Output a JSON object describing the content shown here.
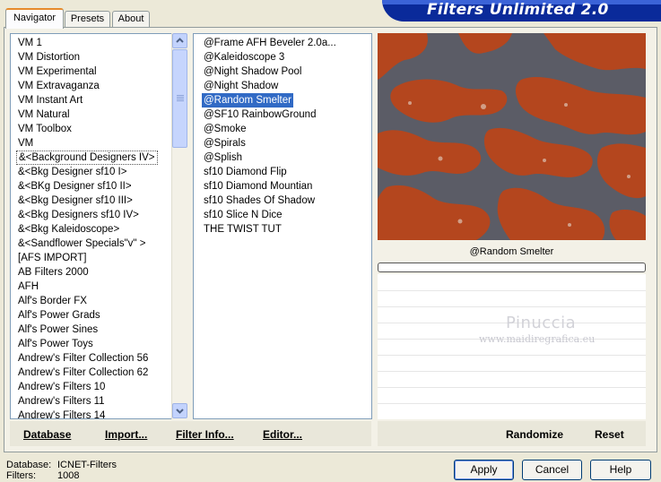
{
  "tabs": [
    "Navigator",
    "Presets",
    "About"
  ],
  "banner_title": "Filters Unlimited 2.0",
  "categories": [
    "VM 1",
    "VM Distortion",
    "VM Experimental",
    "VM Extravaganza",
    "VM Instant Art",
    "VM Natural",
    "VM Toolbox",
    "VM",
    "&<Background Designers IV>",
    "&<Bkg Designer sf10 I>",
    "&<BKg Designer sf10 II>",
    "&<Bkg Designer sf10 III>",
    "&<Bkg Designers sf10 IV>",
    "&<Bkg Kaleidoscope>",
    "&<Sandflower Specials\"v\" >",
    "[AFS IMPORT]",
    "AB Filters 2000",
    "AFH",
    "Alf's Border FX",
    "Alf's Power Grads",
    "Alf's Power Sines",
    "Alf's Power Toys",
    "Andrew's Filter Collection 56",
    "Andrew's Filter Collection 62",
    "Andrew's Filters 10",
    "Andrew's Filters 11",
    "Andrew's Filters 14"
  ],
  "selected_category": "&<Background Designers IV>",
  "filters": [
    "@Frame AFH Beveler 2.0a...",
    "@Kaleidoscope 3",
    "@Night Shadow Pool",
    "@Night Shadow",
    "@Random Smelter",
    "@SF10 RainbowGround",
    "@Smoke",
    "@Spirals",
    "@Splish",
    "sf10 Diamond Flip",
    "sf10 Diamond Mountian",
    "sf10 Shades Of Shadow",
    "sf10 Slice N Dice",
    "THE TWIST TUT"
  ],
  "selected_filter": "@Random Smelter",
  "preview_filter_name": "@Random Smelter",
  "watermark_name": "Pinuccia",
  "watermark_url": "www.maidiregrafica.eu",
  "toolbar": {
    "database": "Database",
    "import": "Import...",
    "filter_info": "Filter Info...",
    "editor": "Editor...",
    "randomize": "Randomize",
    "reset": "Reset"
  },
  "footer": {
    "database_label": "Database:",
    "database_value": "ICNET-Filters",
    "filters_label": "Filters:",
    "filters_value": "1008"
  },
  "buttons": {
    "apply": "Apply",
    "cancel": "Cancel",
    "help": "Help"
  },
  "colors": {
    "preview_gray": "#5B5C66",
    "preview_rust": "#B4461E",
    "selection": "#316AC5",
    "banner": "#0A2A9A"
  }
}
